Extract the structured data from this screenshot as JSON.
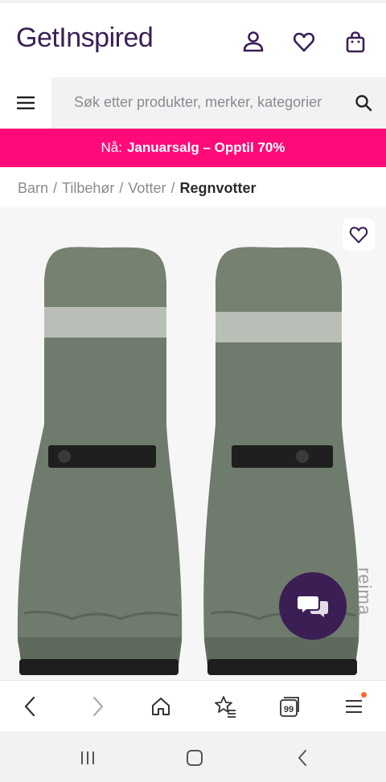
{
  "header": {
    "logo_text": "GetInspired",
    "icons": [
      "user-icon",
      "heart-icon",
      "shopping-bag-icon"
    ]
  },
  "search": {
    "placeholder": "Søk etter produkter, merker, kategorier"
  },
  "promo": {
    "prefix": "Nå:",
    "text": "Januarsalg – Opptil 70%"
  },
  "breadcrumb": {
    "items": [
      "Barn",
      "Tilbehør",
      "Votter"
    ],
    "separator": "/",
    "current": "Regnvotter"
  },
  "product": {
    "brand_mark": "reima",
    "image_description_icon": "rain-mittens-image"
  },
  "browser_nav": {
    "tab_count": "99"
  },
  "colors": {
    "brand": "#3b1e54",
    "promo": "#ff0a78",
    "mitten": "#6f7b6c"
  }
}
